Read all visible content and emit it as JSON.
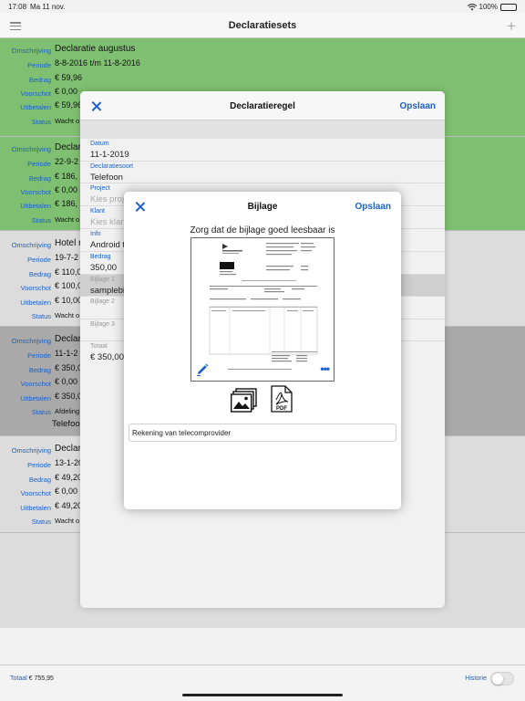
{
  "status_bar": {
    "time": "17:08",
    "date": "Ma 11 nov.",
    "battery": "100%"
  },
  "nav": {
    "title": "Declaratiesets"
  },
  "labels": {
    "omschrijving": "Omschrijving",
    "periode": "Periode",
    "bedrag": "Bedrag",
    "voorschot": "Voorschot",
    "uitbetalen": "Uitbetalen",
    "status": "Status"
  },
  "sets": [
    {
      "omschrijving": "Declaratie augustus",
      "periode": "8-8-2016 t/m 11-8-2016",
      "bedrag": "€ 59,96",
      "voorschot": "€ 0,00",
      "uitbetalen": "€ 59,96",
      "status": "Wacht o"
    },
    {
      "omschrijving": "Declar",
      "periode": "22-9-2",
      "bedrag": "€ 186,",
      "voorschot": "€ 0,00",
      "uitbetalen": "€ 186,",
      "status": "Wacht o"
    },
    {
      "omschrijving": "Hotel n",
      "periode": "19-7-2",
      "bedrag": "€ 110,0",
      "voorschot": "€ 100,0",
      "uitbetalen": "€ 10,00",
      "status": "Wacht o"
    },
    {
      "omschrijving": "Declar",
      "periode": "11-1-2",
      "bedrag": "€ 350,0",
      "voorschot": "€ 0,00",
      "uitbetalen": "€ 350,0",
      "status": "Afdeling",
      "extra": "Telefoo"
    },
    {
      "omschrijving": "Declar",
      "periode": "13-1-20",
      "bedrag": "€ 49,20",
      "voorschot": "€ 0,00",
      "uitbetalen": "€ 49,20",
      "status": "Wacht o"
    }
  ],
  "bottom": {
    "total_label": "Totaal",
    "total_value": "€ 755,95",
    "history_label": "Historie"
  },
  "declaratieregel": {
    "title": "Declaratieregel",
    "save": "Opslaan",
    "fields": [
      {
        "label": "Datum",
        "value": "11-1-2019"
      },
      {
        "label": "Declaratiesoort",
        "value": "Telefoon"
      },
      {
        "label": "Project",
        "value": "Kies proje"
      },
      {
        "label": "Klant",
        "value": "Kies klan"
      },
      {
        "label": "Info",
        "value": "Android t"
      },
      {
        "label": "Bedrag",
        "value": "350,00"
      },
      {
        "label": "Bijlage 1",
        "value": "samplebi"
      },
      {
        "label": "Bijlage 2",
        "value": ""
      },
      {
        "label": "Bijlage 3",
        "value": ""
      },
      {
        "label": "Totaal",
        "value": "€ 350,00"
      }
    ]
  },
  "bijlage": {
    "title": "Bijlage",
    "save": "Opslaan",
    "instruction": "Zorg dat de bijlage goed leesbaar is",
    "description_value": "Rekening van telecomprovider",
    "pdf_label": "PDF"
  },
  "colors": {
    "accent": "#1a61c8",
    "green_card": "#7fbf71"
  }
}
